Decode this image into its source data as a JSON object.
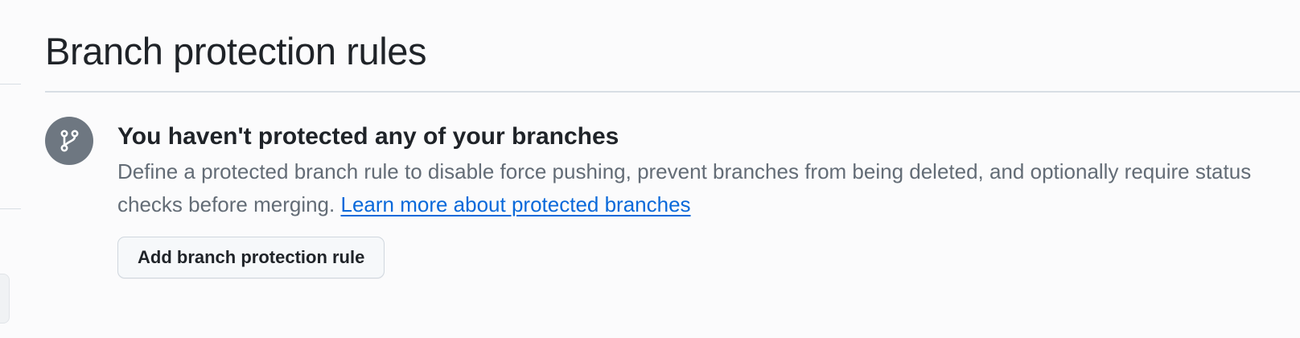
{
  "header": {
    "title": "Branch protection rules"
  },
  "blankslate": {
    "icon": "git-branch-icon",
    "icon_bg_color": "#6e7781",
    "heading": "You haven't protected any of your branches",
    "description": "Define a protected branch rule to disable force pushing, prevent branches from being deleted, and optionally require status checks before merging.",
    "learn_more_link": "Learn more about protected branches",
    "link_color": "#0969da",
    "add_button_label": "Add branch protection rule"
  }
}
